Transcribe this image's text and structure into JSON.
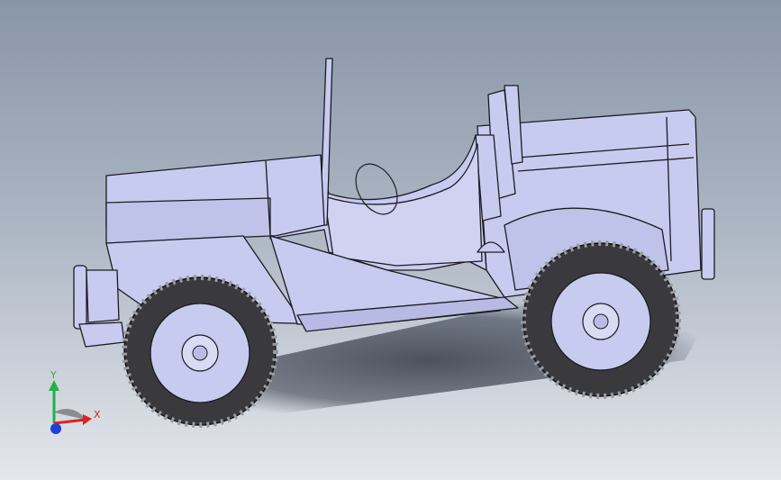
{
  "viewport": {
    "background_top": "#8996a8",
    "background_bottom": "#e4e7ec",
    "model_fill": "#c7cbef",
    "edge_color": "#1c1c22",
    "tire_color": "#3a3a3e"
  },
  "triad": {
    "x_label": "X",
    "y_label": "Y",
    "x_color": "#e02020",
    "y_color": "#22b14c",
    "z_color": "#1f3fd8"
  }
}
